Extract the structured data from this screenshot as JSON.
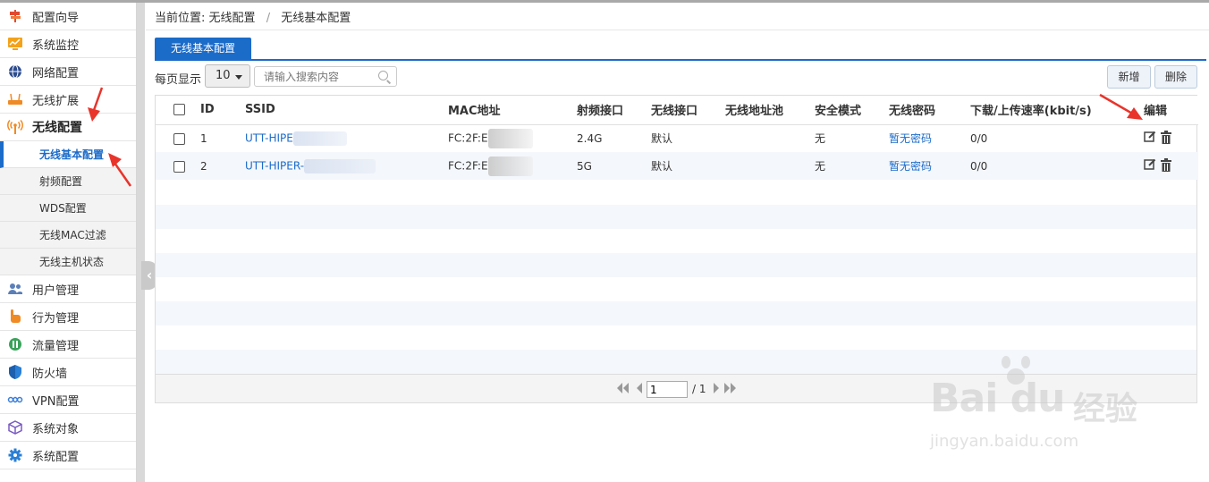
{
  "sidebar": {
    "items": [
      {
        "label": "配置向导",
        "icon": "signpost-icon"
      },
      {
        "label": "系统监控",
        "icon": "monitor-icon"
      },
      {
        "label": "网络配置",
        "icon": "globe-icon"
      },
      {
        "label": "无线扩展",
        "icon": "router-icon"
      },
      {
        "label": "无线配置",
        "icon": "wireless-icon"
      },
      {
        "label": "用户管理",
        "icon": "users-icon"
      },
      {
        "label": "行为管理",
        "icon": "hand-icon"
      },
      {
        "label": "流量管理",
        "icon": "traffic-icon"
      },
      {
        "label": "防火墙",
        "icon": "shield-icon"
      },
      {
        "label": "VPN配置",
        "icon": "vpn-icon"
      },
      {
        "label": "系统对象",
        "icon": "cube-icon"
      },
      {
        "label": "系统配置",
        "icon": "gear-icon"
      }
    ],
    "submenu": [
      "无线基本配置",
      "射频配置",
      "WDS配置",
      "无线MAC过滤",
      "无线主机状态"
    ]
  },
  "breadcrumb": {
    "prefix": "当前位置:",
    "section": "无线配置",
    "separator": "/",
    "page": "无线基本配置"
  },
  "tab": {
    "label": "无线基本配置"
  },
  "toolbar": {
    "per_page_label": "每页显示",
    "per_page_value": "10",
    "search_placeholder": "请输入搜索内容",
    "add_label": "新增",
    "delete_label": "删除"
  },
  "table": {
    "headers": [
      "ID",
      "SSID",
      "MAC地址",
      "射频接口",
      "无线接口",
      "无线地址池",
      "安全模式",
      "无线密码",
      "下载/上传速率(kbit/s)",
      "编辑"
    ],
    "rows": [
      {
        "id": "1",
        "ssid": "UTT-HIPE",
        "mac": "FC:2F:E",
        "radio": "2.4G",
        "wlan": "默认",
        "pool": "",
        "security": "无",
        "password": "暂无密码",
        "rate": "0/0"
      },
      {
        "id": "2",
        "ssid": "UTT-HIPER-",
        "mac": "FC:2F:E",
        "radio": "5G",
        "wlan": "默认",
        "pool": "",
        "security": "无",
        "password": "暂无密码",
        "rate": "0/0"
      }
    ]
  },
  "pager": {
    "current": "1",
    "total": "/ 1"
  },
  "watermark": {
    "logo": "Bai du",
    "cn": "经验",
    "url": "jingyan.baidu.com"
  },
  "colors": {
    "accent": "#1b6bc9",
    "annotation": "#e8342b"
  }
}
